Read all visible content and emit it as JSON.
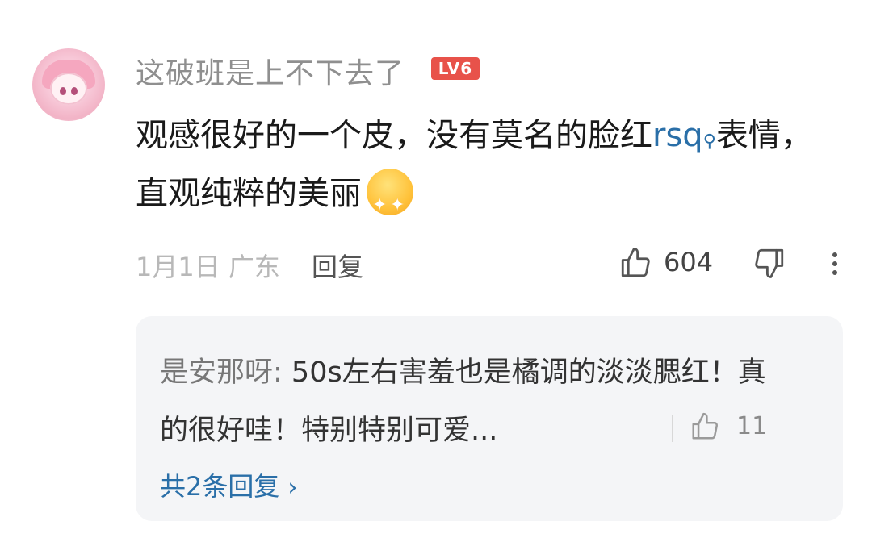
{
  "comment": {
    "username": "这破班是上不下去了",
    "level_badge": "LV6",
    "text_before_link": "观感很好的一个皮，没有莫名的脸红",
    "link_text": "rsq",
    "text_after_link": "表情，直观纯粹的美丽",
    "emoji_name": "starry-eyed-emoji",
    "date": "1月1日",
    "location": "广东",
    "reply_label": "回复",
    "like_count": "604"
  },
  "reply_preview": {
    "user": "是安那呀:",
    "text": " 50s左右害羞也是橘调的淡淡腮红！真的很好哇！特别特别可爱...",
    "like_count": "11",
    "total_replies": "共2条回复"
  },
  "icons": {
    "like": "thumbs-up-icon",
    "dislike": "thumbs-down-icon",
    "more": "more-vertical-icon",
    "search": "search-icon",
    "chevron": "chevron-right-icon"
  },
  "colors": {
    "badge": "#e8524a",
    "link": "#2a6fa8",
    "reply_bg": "#f4f5f7"
  }
}
